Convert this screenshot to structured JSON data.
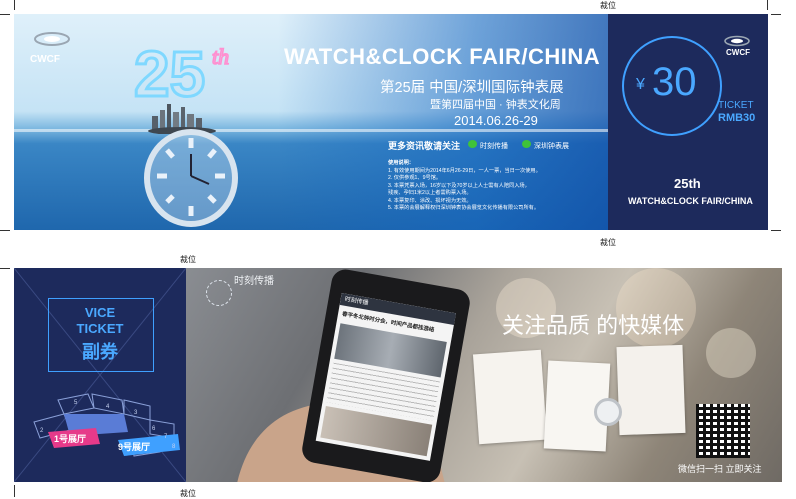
{
  "marks": {
    "top": "裁位",
    "mid_right": "裁位",
    "mid_left": "裁位",
    "bottom": "裁位"
  },
  "brand": {
    "cwcf": "CWCF"
  },
  "ticket": {
    "title_en": "WATCH&CLOCK FAIR/CHINA",
    "title_cn": "第25届 中国/深圳国际钟表展",
    "subtitle_cn": "暨第四届中国 · 钟表文化周",
    "date": "2014.06.26-29",
    "follow": "更多资讯敬请关注",
    "wechat_1": "时刻传播",
    "wechat_2": "深圳钟表展",
    "notes_title": "使用说明：",
    "notes": [
      "1. 有效使用期间为2014年6月26-29日，一人一票，当日一次使用。",
      "2. 仅供参观1、9号馆。",
      "3. 本票凭票入场，16岁以下及70岁以上人士需有人陪同入场，",
      "   残疾、孕妇1米2以上者需购票入场。",
      "4. 本票复印、涂改、损坏视为无效。",
      "5. 本票的会展解释权归深圳钟表协会展览文化传播有限公司所有。"
    ]
  },
  "stub": {
    "price": "30",
    "currency": "¥",
    "ticket_label": "TICKET",
    "rmb": "RMB30",
    "badge": "25th",
    "fair": "WATCH&CLOCK FAIR/CHINA"
  },
  "vice": {
    "line1": "VICE",
    "line2": "TICKET",
    "line3": "副券",
    "hall_1": "1号展厅",
    "hall_9": "9号展厅",
    "hall_numbers": [
      "5",
      "4",
      "3",
      "2",
      "6",
      "7",
      "8"
    ]
  },
  "promo": {
    "logo_text": "时刻传播",
    "headline": "关注品质 的快媒体",
    "scan": "微信扫一扫 立即关注",
    "phone_header": "时刻传播",
    "article_title": "春平冬北钟时分会，时间产品都挂游络",
    "bg_colors": {
      "stub": "#1d2a5c",
      "accent": "#3fa0ff",
      "hall": "#e63a8a"
    }
  }
}
